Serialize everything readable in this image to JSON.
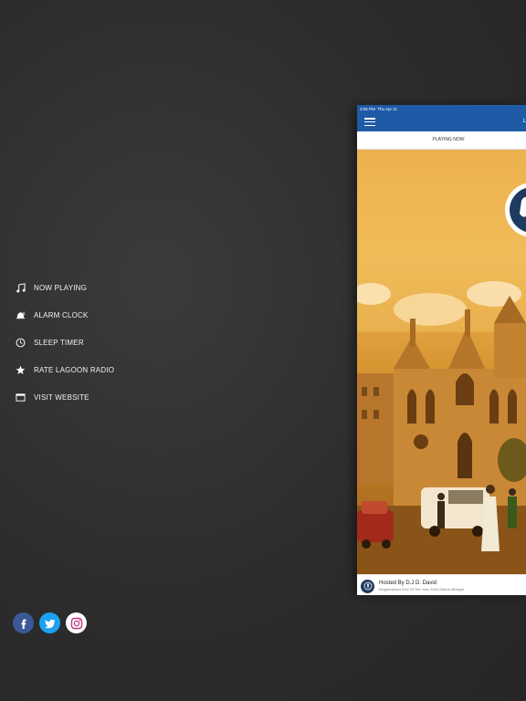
{
  "menu": {
    "items": [
      {
        "label": "NOW PLAYING",
        "icon": "music-note-icon"
      },
      {
        "label": "ALARM CLOCK",
        "icon": "alarm-bell-icon"
      },
      {
        "label": "SLEEP TIMER",
        "icon": "clock-icon"
      },
      {
        "label": "RATE LAGOON RADIO",
        "icon": "star-icon"
      },
      {
        "label": "VISIT WEBSITE",
        "icon": "browser-window-icon"
      }
    ]
  },
  "social": [
    {
      "network": "facebook",
      "icon": "facebook-icon",
      "color": "#3b5998"
    },
    {
      "network": "twitter",
      "icon": "twitter-icon",
      "color": "#1da1f2"
    },
    {
      "network": "instagram",
      "icon": "instagram-icon",
      "color": "#c13584"
    }
  ],
  "device": {
    "status": {
      "time": "3:05 PM",
      "date": "Thu Apr 11"
    },
    "nav": {
      "title": "L"
    },
    "tab": {
      "label": "PLAYING NOW"
    },
    "player": {
      "title": "Hosted By D.J D. David",
      "subtitle": "Kingdomkonz End Of The Year 2018 Gbedu Mixtape"
    }
  },
  "colors": {
    "accent": "#1e5aa6",
    "background": "#2e2e2e"
  }
}
